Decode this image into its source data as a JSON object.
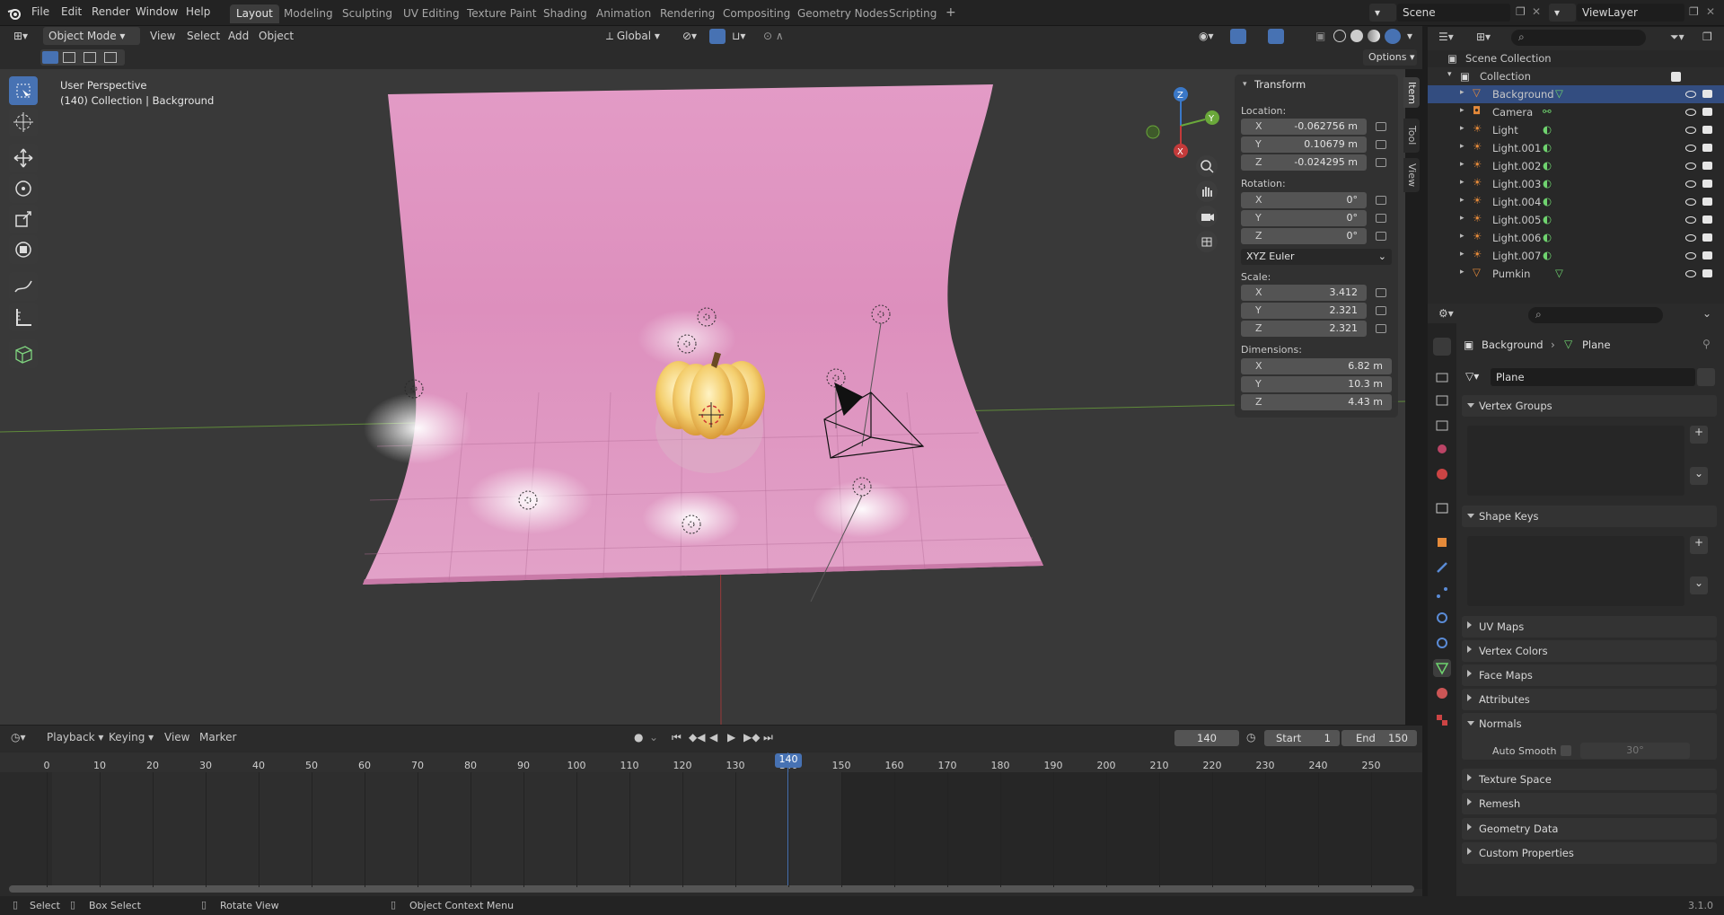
{
  "topbar": {
    "menus": [
      "File",
      "Edit",
      "Render",
      "Window",
      "Help"
    ],
    "workspaces": [
      "Layout",
      "Modeling",
      "Sculpting",
      "UV Editing",
      "Texture Paint",
      "Shading",
      "Animation",
      "Rendering",
      "Compositing",
      "Geometry Nodes",
      "Scripting"
    ],
    "active_workspace": "Layout",
    "add_tab": "+",
    "scene": "Scene",
    "view_layer": "ViewLayer"
  },
  "viewport_header": {
    "mode": "Object Mode",
    "menus": [
      "View",
      "Select",
      "Add",
      "Object"
    ],
    "orientation": "Global",
    "options": "Options"
  },
  "viewport": {
    "perspective": "User Perspective",
    "collection_info": "(140) Collection | Background",
    "gizmo_axes": {
      "x": "X",
      "y": "Y",
      "z": "Z"
    }
  },
  "npanel": {
    "tabs": [
      "Item",
      "Tool",
      "View"
    ],
    "title": "Transform",
    "location_label": "Location:",
    "location": [
      {
        "axis": "X",
        "value": "-0.062756 m"
      },
      {
        "axis": "Y",
        "value": "0.10679 m"
      },
      {
        "axis": "Z",
        "value": "-0.024295 m"
      }
    ],
    "rotation_label": "Rotation:",
    "rotation": [
      {
        "axis": "X",
        "value": "0°"
      },
      {
        "axis": "Y",
        "value": "0°"
      },
      {
        "axis": "Z",
        "value": "0°"
      }
    ],
    "rotation_mode": "XYZ Euler",
    "scale_label": "Scale:",
    "scale": [
      {
        "axis": "X",
        "value": "3.412"
      },
      {
        "axis": "Y",
        "value": "2.321"
      },
      {
        "axis": "Z",
        "value": "2.321"
      }
    ],
    "dimensions_label": "Dimensions:",
    "dimensions": [
      {
        "axis": "X",
        "value": "6.82 m"
      },
      {
        "axis": "Y",
        "value": "10.3 m"
      },
      {
        "axis": "Z",
        "value": "4.43 m"
      }
    ]
  },
  "outliner": {
    "root": "Scene Collection",
    "collection": "Collection",
    "items": [
      "Background",
      "Camera",
      "Light",
      "Light.001",
      "Light.002",
      "Light.003",
      "Light.004",
      "Light.005",
      "Light.006",
      "Light.007",
      "Pumkin"
    ]
  },
  "properties": {
    "breadcrumb_object": "Background",
    "breadcrumb_data": "Plane",
    "mesh_name": "Plane",
    "panels": [
      "Vertex Groups",
      "Shape Keys",
      "UV Maps",
      "Vertex Colors",
      "Face Maps",
      "Attributes",
      "Normals",
      "Texture Space",
      "Remesh",
      "Geometry Data",
      "Custom Properties"
    ],
    "auto_smooth_label": "Auto Smooth",
    "auto_smooth_angle": "30°"
  },
  "timeline": {
    "menus": [
      "Playback",
      "Keying",
      "View",
      "Marker"
    ],
    "current_frame": "140",
    "start_label": "Start",
    "start": "1",
    "end_label": "End",
    "end": "150",
    "ticks": [
      "0",
      "10",
      "20",
      "30",
      "40",
      "50",
      "60",
      "70",
      "80",
      "90",
      "100",
      "110",
      "120",
      "130",
      "140",
      "150",
      "160",
      "170",
      "180",
      "190",
      "200",
      "210",
      "220",
      "230",
      "240",
      "250"
    ]
  },
  "statusbar": {
    "select": "Select",
    "box_select": "Box Select",
    "rotate_view": "Rotate View",
    "context_menu": "Object Context Menu",
    "version": "3.1.0"
  },
  "colors": {
    "accent": "#4772b3",
    "selected_blue": "#5a8bd6",
    "pink_plane": "#d98ab8",
    "x_axis": "#c33a3a",
    "y_axis": "#6aa83a",
    "z_axis": "#3a78c8"
  }
}
